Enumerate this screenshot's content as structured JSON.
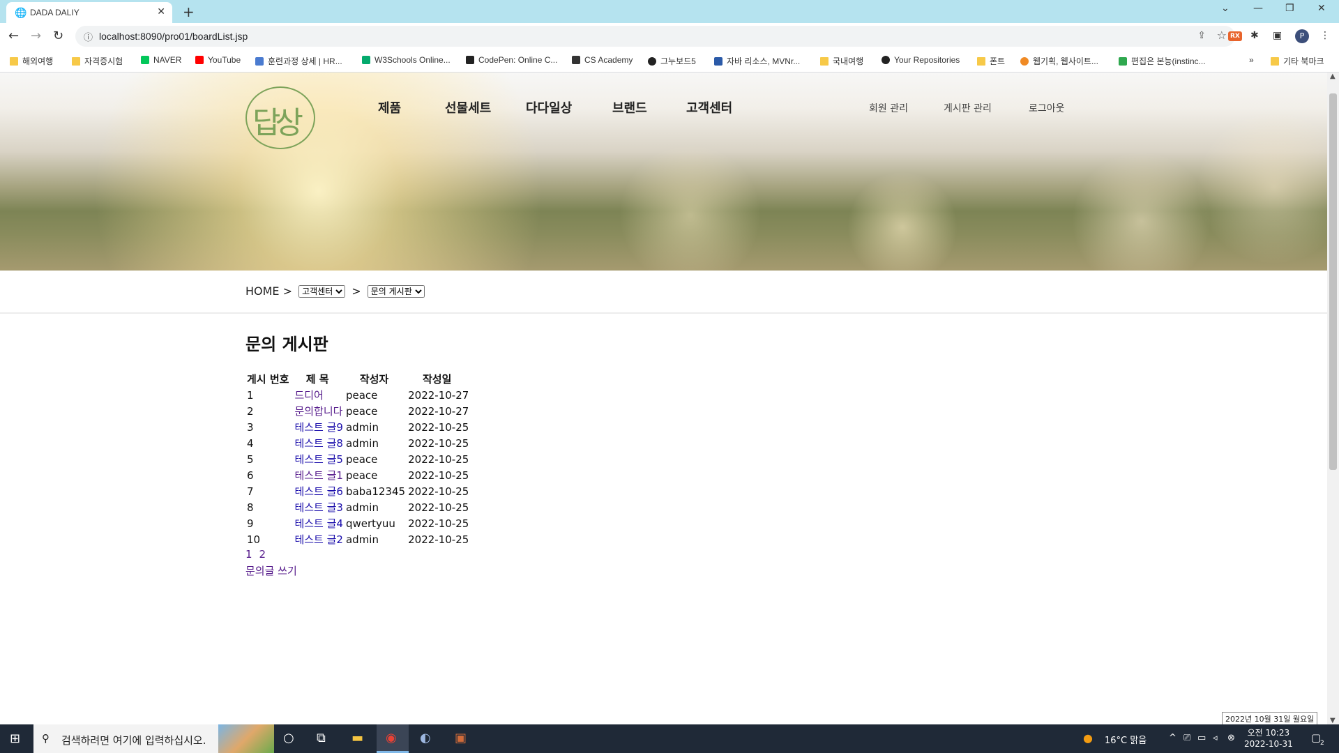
{
  "browser": {
    "tab_title": "DADA DALIY",
    "url": "localhost:8090/pro01/boardList.jsp",
    "window_controls": [
      "⌄",
      "—",
      "❐",
      "✕"
    ]
  },
  "bookmarks": [
    {
      "label": "해외여행",
      "icon": "folder"
    },
    {
      "label": "자격증시험",
      "icon": "folder"
    },
    {
      "label": "NAVER",
      "icon": "naver"
    },
    {
      "label": "YouTube",
      "icon": "youtube"
    },
    {
      "label": "훈련과정 상세 | HR...",
      "icon": "hrd"
    },
    {
      "label": "W3Schools Online...",
      "icon": "w3"
    },
    {
      "label": "CodePen: Online C...",
      "icon": "codepen"
    },
    {
      "label": "CS Academy",
      "icon": "cs"
    },
    {
      "label": "그누보드5",
      "icon": "gnu"
    },
    {
      "label": "자바 리소스, MVNr...",
      "icon": "mvn"
    },
    {
      "label": "국내여행",
      "icon": "folder"
    },
    {
      "label": "Your Repositories",
      "icon": "github"
    },
    {
      "label": "폰트",
      "icon": "folder"
    },
    {
      "label": "웹기획, 웹사이트...",
      "icon": "o"
    },
    {
      "label": "편집은 본능(instinc...",
      "icon": "green"
    },
    {
      "label": "기타 북마크",
      "icon": "folder"
    }
  ],
  "site": {
    "logo_text": "답상",
    "main_nav": [
      "제품",
      "선물세트",
      "다다일상",
      "브랜드",
      "고객센터"
    ],
    "sub_nav": [
      "회원 관리",
      "게시판 관리",
      "로그아웃"
    ]
  },
  "breadcrumb": {
    "home": "HOME",
    "sep": ">",
    "select1": "고객센터",
    "select2": "문의 게시판"
  },
  "board": {
    "title": "문의 게시판",
    "headers": [
      "게시 번호",
      "제 목",
      "작성자",
      "작성일"
    ],
    "rows": [
      {
        "no": "1",
        "title": "드디어",
        "author": "peace",
        "date": "2022-10-27"
      },
      {
        "no": "2",
        "title": "문의합니다",
        "author": "peace",
        "date": "2022-10-27"
      },
      {
        "no": "3",
        "title": "테스트 글9",
        "author": "admin",
        "date": "2022-10-25"
      },
      {
        "no": "4",
        "title": "테스트 글8",
        "author": "admin",
        "date": "2022-10-25"
      },
      {
        "no": "5",
        "title": "테스트 글5",
        "author": "peace",
        "date": "2022-10-25"
      },
      {
        "no": "6",
        "title": "테스트 글1",
        "author": "peace",
        "date": "2022-10-25"
      },
      {
        "no": "7",
        "title": "테스트 글6",
        "author": "baba12345",
        "date": "2022-10-25"
      },
      {
        "no": "8",
        "title": "테스트 글3",
        "author": "admin",
        "date": "2022-10-25"
      },
      {
        "no": "9",
        "title": "테스트 글4",
        "author": "qwertyuu",
        "date": "2022-10-25"
      },
      {
        "no": "10",
        "title": "테스트 글2",
        "author": "admin",
        "date": "2022-10-25"
      }
    ],
    "pages": [
      "1",
      "2"
    ],
    "write_link": "문의글 쓰기"
  },
  "date_tooltip": "2022년 10월 31일 월요일",
  "taskbar": {
    "search_placeholder": "검색하려면 여기에 입력하십시오.",
    "weather": "16°C  맑음",
    "time": "오전 10:23",
    "date": "2022-10-31",
    "notifications": "2"
  },
  "colors": {
    "tab_strip": "#b5e3ef",
    "logo_green": "#7da35a",
    "visited_link": "#551a8b",
    "taskbar": "#1f2937"
  }
}
